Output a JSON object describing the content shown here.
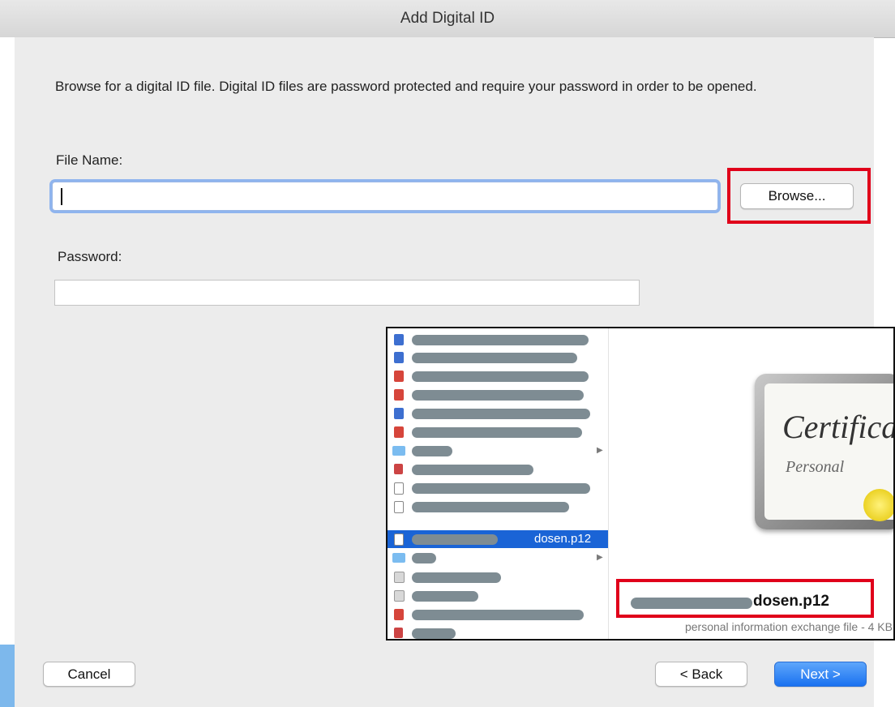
{
  "dialog": {
    "title": "Add Digital ID",
    "description": "Browse for a digital ID file. Digital ID files are password protected and require your password in order to be opened.",
    "file_name_label": "File Name:",
    "file_name_value": "",
    "browse_label": "Browse...",
    "password_label": "Password:",
    "password_value": "",
    "cancel_label": "Cancel",
    "back_label": "< Back",
    "next_label": "Next >"
  },
  "file_browser": {
    "items": [
      {
        "icon": "word-doc-icon",
        "label": ""
      },
      {
        "icon": "word-doc-icon",
        "label": ""
      },
      {
        "icon": "pdf-icon",
        "label": ""
      },
      {
        "icon": "pdf-icon",
        "label": ""
      },
      {
        "icon": "word-doc-icon",
        "label": ""
      },
      {
        "icon": "pdf-icon",
        "label": ""
      },
      {
        "icon": "folder-icon",
        "label": ""
      },
      {
        "icon": "image-icon",
        "label": ""
      },
      {
        "icon": "certificate-icon",
        "label": ""
      },
      {
        "icon": "certificate-icon",
        "label": ""
      },
      {
        "icon": "certificate-icon",
        "label": "dosen.p12",
        "selected": true
      },
      {
        "icon": "folder-icon",
        "label": ""
      },
      {
        "icon": "presentation-icon",
        "label": ""
      },
      {
        "icon": "presentation-icon",
        "label": ""
      },
      {
        "icon": "pdf-icon",
        "label": ""
      },
      {
        "icon": "image-icon",
        "label": ""
      }
    ],
    "preview": {
      "certificate_title": "Certifica",
      "certificate_subtitle": "Personal",
      "file_name": "dosen.p12",
      "file_description": "personal information exchange file - 4 KB"
    }
  },
  "colors": {
    "highlight": "#e0001a",
    "selection": "#1a64d6",
    "primary_button": "#1a72f0"
  }
}
